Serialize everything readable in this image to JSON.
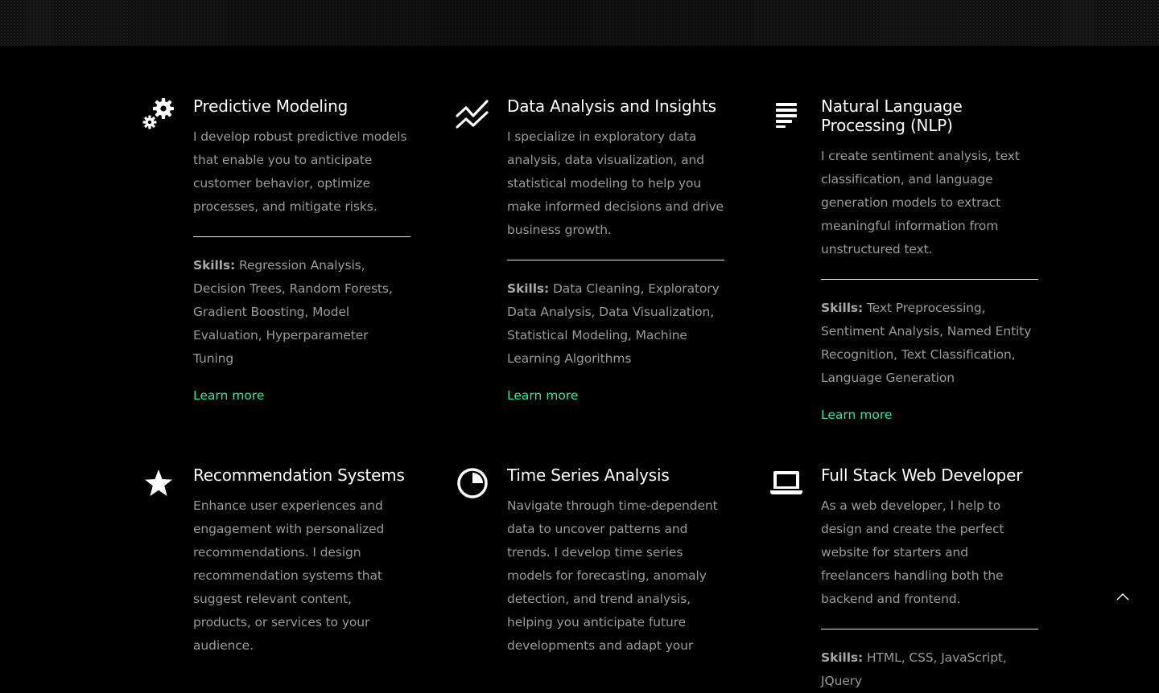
{
  "services": [
    {
      "title": "Predictive Modeling",
      "description": "I develop robust predictive models that enable you to anticipate customer behavior, optimize processes, and mitigate risks.",
      "skills_label": "Skills:",
      "skills": "Regression Analysis, Decision Trees, Random Forests, Gradient Boosting, Model Evaluation, Hyperparameter Tuning",
      "link": "Learn more",
      "icon": "gears-icon"
    },
    {
      "title": "Data Analysis and Insights",
      "description": "I specialize in exploratory data analysis, data visualization, and statistical modeling to help you make informed decisions and drive business growth.",
      "skills_label": "Skills:",
      "skills": "Data Cleaning, Exploratory Data Analysis, Data Visualization, Statistical Modeling, Machine Learning Algorithms",
      "link": "Learn more",
      "icon": "line-chart-icon"
    },
    {
      "title": "Natural Language Processing (NLP)",
      "description": "I create sentiment analysis, text classification, and language generation models to extract meaningful information from unstructured text.",
      "skills_label": "Skills:",
      "skills": "Text Preprocessing, Sentiment Analysis, Named Entity Recognition, Text Classification, Language Generation",
      "link": "Learn more",
      "icon": "align-left-icon"
    },
    {
      "title": "Recommendation Systems",
      "description": "Enhance user experiences and engagement with personalized recommendations. I design recommendation systems that suggest relevant content, products, or services to your audience.",
      "icon": "star-icon"
    },
    {
      "title": "Time Series Analysis",
      "description": "Navigate through time-dependent data to uncover patterns and trends. I develop time series models for forecasting, anomaly detection, and trend analysis, helping you anticipate future developments and adapt your",
      "icon": "pie-chart-icon"
    },
    {
      "title": "Full Stack Web Developer",
      "description": "As a web developer, I help to design and create the perfect website for starters and freelancers handling both the backend and frontend.",
      "skills_label": "Skills:",
      "skills": "HTML, CSS, JavaScript, JQuery",
      "icon": "laptop-icon"
    }
  ],
  "colors": {
    "accent": "#2ee59d",
    "heading": "#ffffff",
    "body": "#9a9a9a",
    "background": "#000000"
  },
  "back_to_top_icon": "chevron-up-icon"
}
